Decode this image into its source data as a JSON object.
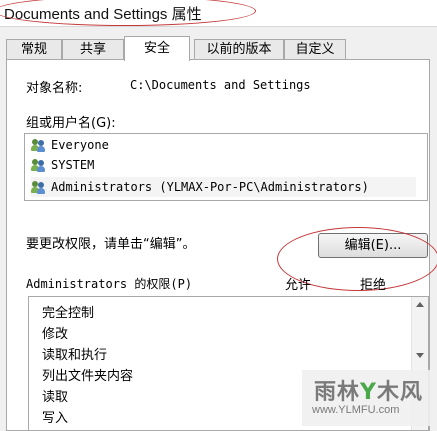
{
  "window": {
    "title": "Documents and Settings 属性"
  },
  "tabs": [
    {
      "label": "常规"
    },
    {
      "label": "共享"
    },
    {
      "label": "安全"
    },
    {
      "label": "以前的版本"
    },
    {
      "label": "自定义"
    }
  ],
  "active_tab": "安全",
  "security": {
    "object_name_label": "对象名称:",
    "object_name_value": "C:\\Documents and Settings",
    "groups_label": "组或用户名(G):",
    "users": [
      {
        "name": "Everyone"
      },
      {
        "name": "SYSTEM"
      },
      {
        "name": "Administrators (YLMAX-Por-PC\\Administrators)"
      }
    ],
    "change_hint": "要更改权限，请单击“编辑”。",
    "edit_button": "编辑(E)...",
    "perm_label": "Administrators 的权限(P)",
    "allow_header": "允许",
    "deny_header": "拒绝",
    "permissions": [
      {
        "name": "完全控制"
      },
      {
        "name": "修改"
      },
      {
        "name": "读取和执行"
      },
      {
        "name": "列出文件夹内容"
      },
      {
        "name": "读取"
      },
      {
        "name": "写入"
      }
    ]
  },
  "watermark": {
    "line1_a": "雨林",
    "line1_b": "Y",
    "line1_c": "木风",
    "line2": "www.YLMFU.com"
  },
  "colors": {
    "annotation": "#c43a3a",
    "border": "#a9a9a9"
  }
}
